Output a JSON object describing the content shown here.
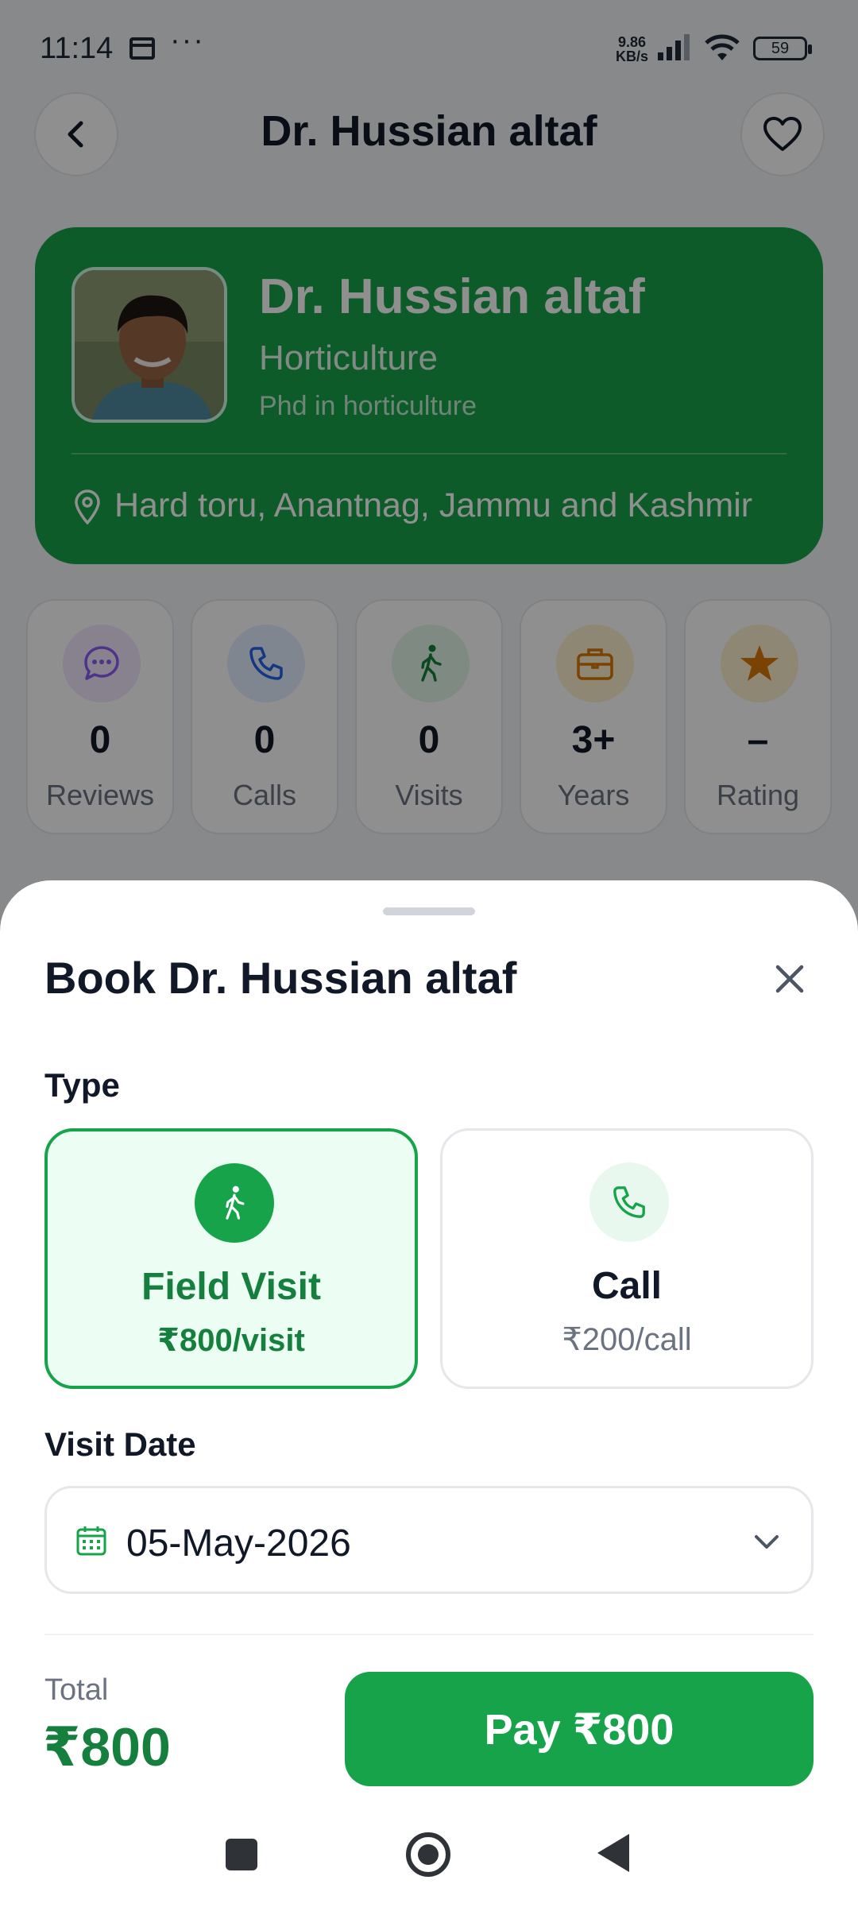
{
  "status_bar": {
    "time": "11:14",
    "dots": "···",
    "net_speed_value": "9.86",
    "net_speed_unit": "KB/s",
    "battery": "59"
  },
  "header": {
    "title": "Dr. Hussian altaf",
    "back_icon": "chevron-left-icon",
    "favorite_icon": "heart-icon"
  },
  "profile": {
    "name": "Dr. Hussian altaf",
    "specialization": "Horticulture",
    "degree": "Phd in horticulture",
    "location": "Hard toru, Anantnag, Jammu and Kashmir",
    "card_color": "#16a34a"
  },
  "stats": [
    {
      "value": "0",
      "label": "Reviews",
      "icon": "chat-bubble-icon",
      "color": "#8b5cf6"
    },
    {
      "value": "0",
      "label": "Calls",
      "icon": "phone-icon",
      "color": "#2563eb"
    },
    {
      "value": "0",
      "label": "Visits",
      "icon": "walking-icon",
      "color": "#16a34a"
    },
    {
      "value": "3+",
      "label": "Years",
      "icon": "briefcase-icon",
      "color": "#d97706"
    },
    {
      "value": "–",
      "label": "Rating",
      "icon": "star-icon",
      "color": "#d97706"
    }
  ],
  "booking": {
    "title": "Book Dr. Hussian altaf",
    "type_label": "Type",
    "options": [
      {
        "name": "Field Visit",
        "price": "₹800/visit",
        "icon": "walking-icon",
        "selected": true
      },
      {
        "name": "Call",
        "price": "₹200/call",
        "icon": "phone-icon",
        "selected": false
      }
    ],
    "date_label": "Visit Date",
    "date_value": "05-May-2026",
    "total_label": "Total",
    "total_value": "₹800",
    "pay_label": "Pay ₹800",
    "accent_color": "#16a34a"
  }
}
